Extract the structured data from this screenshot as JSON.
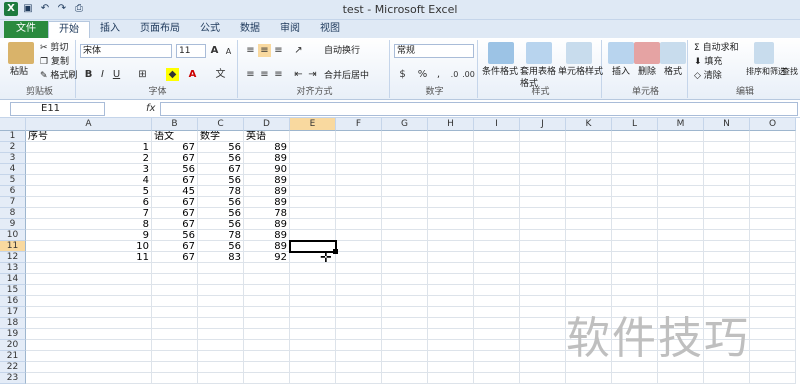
{
  "window": {
    "title": "test - Microsoft Excel"
  },
  "tabs": [
    "文件",
    "开始",
    "插入",
    "页面布局",
    "公式",
    "数据",
    "审阅",
    "视图"
  ],
  "ribbon": {
    "clipboard": {
      "paste": "粘贴",
      "cut": "剪切",
      "copy": "复制",
      "format_painter": "格式刷",
      "label": "剪贴板"
    },
    "font": {
      "name": "宋体",
      "size": "11",
      "label": "字体"
    },
    "alignment": {
      "wrap": "自动换行",
      "merge": "合并后居中",
      "label": "对齐方式"
    },
    "number": {
      "format": "常规",
      "label": "数字"
    },
    "styles": {
      "cond": "条件格式",
      "table": "套用表格格式",
      "cell": "单元格样式",
      "label": "样式"
    },
    "cells": {
      "insert": "插入",
      "delete": "删除",
      "format": "格式",
      "label": "单元格"
    },
    "editing": {
      "autosum": "自动求和",
      "fill": "填充",
      "clear": "清除",
      "sort": "排序和筛选",
      "find": "查找",
      "label": "编辑"
    }
  },
  "formula_bar": {
    "name_box": "E11",
    "fx": "fx",
    "value": ""
  },
  "columns": [
    "A",
    "B",
    "C",
    "D",
    "E",
    "F",
    "G",
    "H",
    "I",
    "J",
    "K",
    "L",
    "M",
    "N",
    "O"
  ],
  "header_row": [
    "序号",
    "语文",
    "数学",
    "英语"
  ],
  "rows": [
    [
      "1",
      "67",
      "56",
      "89"
    ],
    [
      "2",
      "67",
      "56",
      "89"
    ],
    [
      "3",
      "56",
      "67",
      "90"
    ],
    [
      "4",
      "67",
      "56",
      "89"
    ],
    [
      "5",
      "45",
      "78",
      "89"
    ],
    [
      "6",
      "67",
      "56",
      "89"
    ],
    [
      "7",
      "67",
      "56",
      "78"
    ],
    [
      "8",
      "67",
      "56",
      "89"
    ],
    [
      "9",
      "56",
      "78",
      "89"
    ],
    [
      "10",
      "67",
      "56",
      "89"
    ],
    [
      "11",
      "67",
      "83",
      "92"
    ]
  ],
  "row_numbers": [
    "1",
    "2",
    "3",
    "4",
    "5",
    "6",
    "7",
    "8",
    "9",
    "10",
    "11",
    "12",
    "13",
    "14",
    "15",
    "16",
    "17",
    "18",
    "19",
    "20",
    "21",
    "22",
    "23"
  ],
  "watermark": "软件技巧"
}
